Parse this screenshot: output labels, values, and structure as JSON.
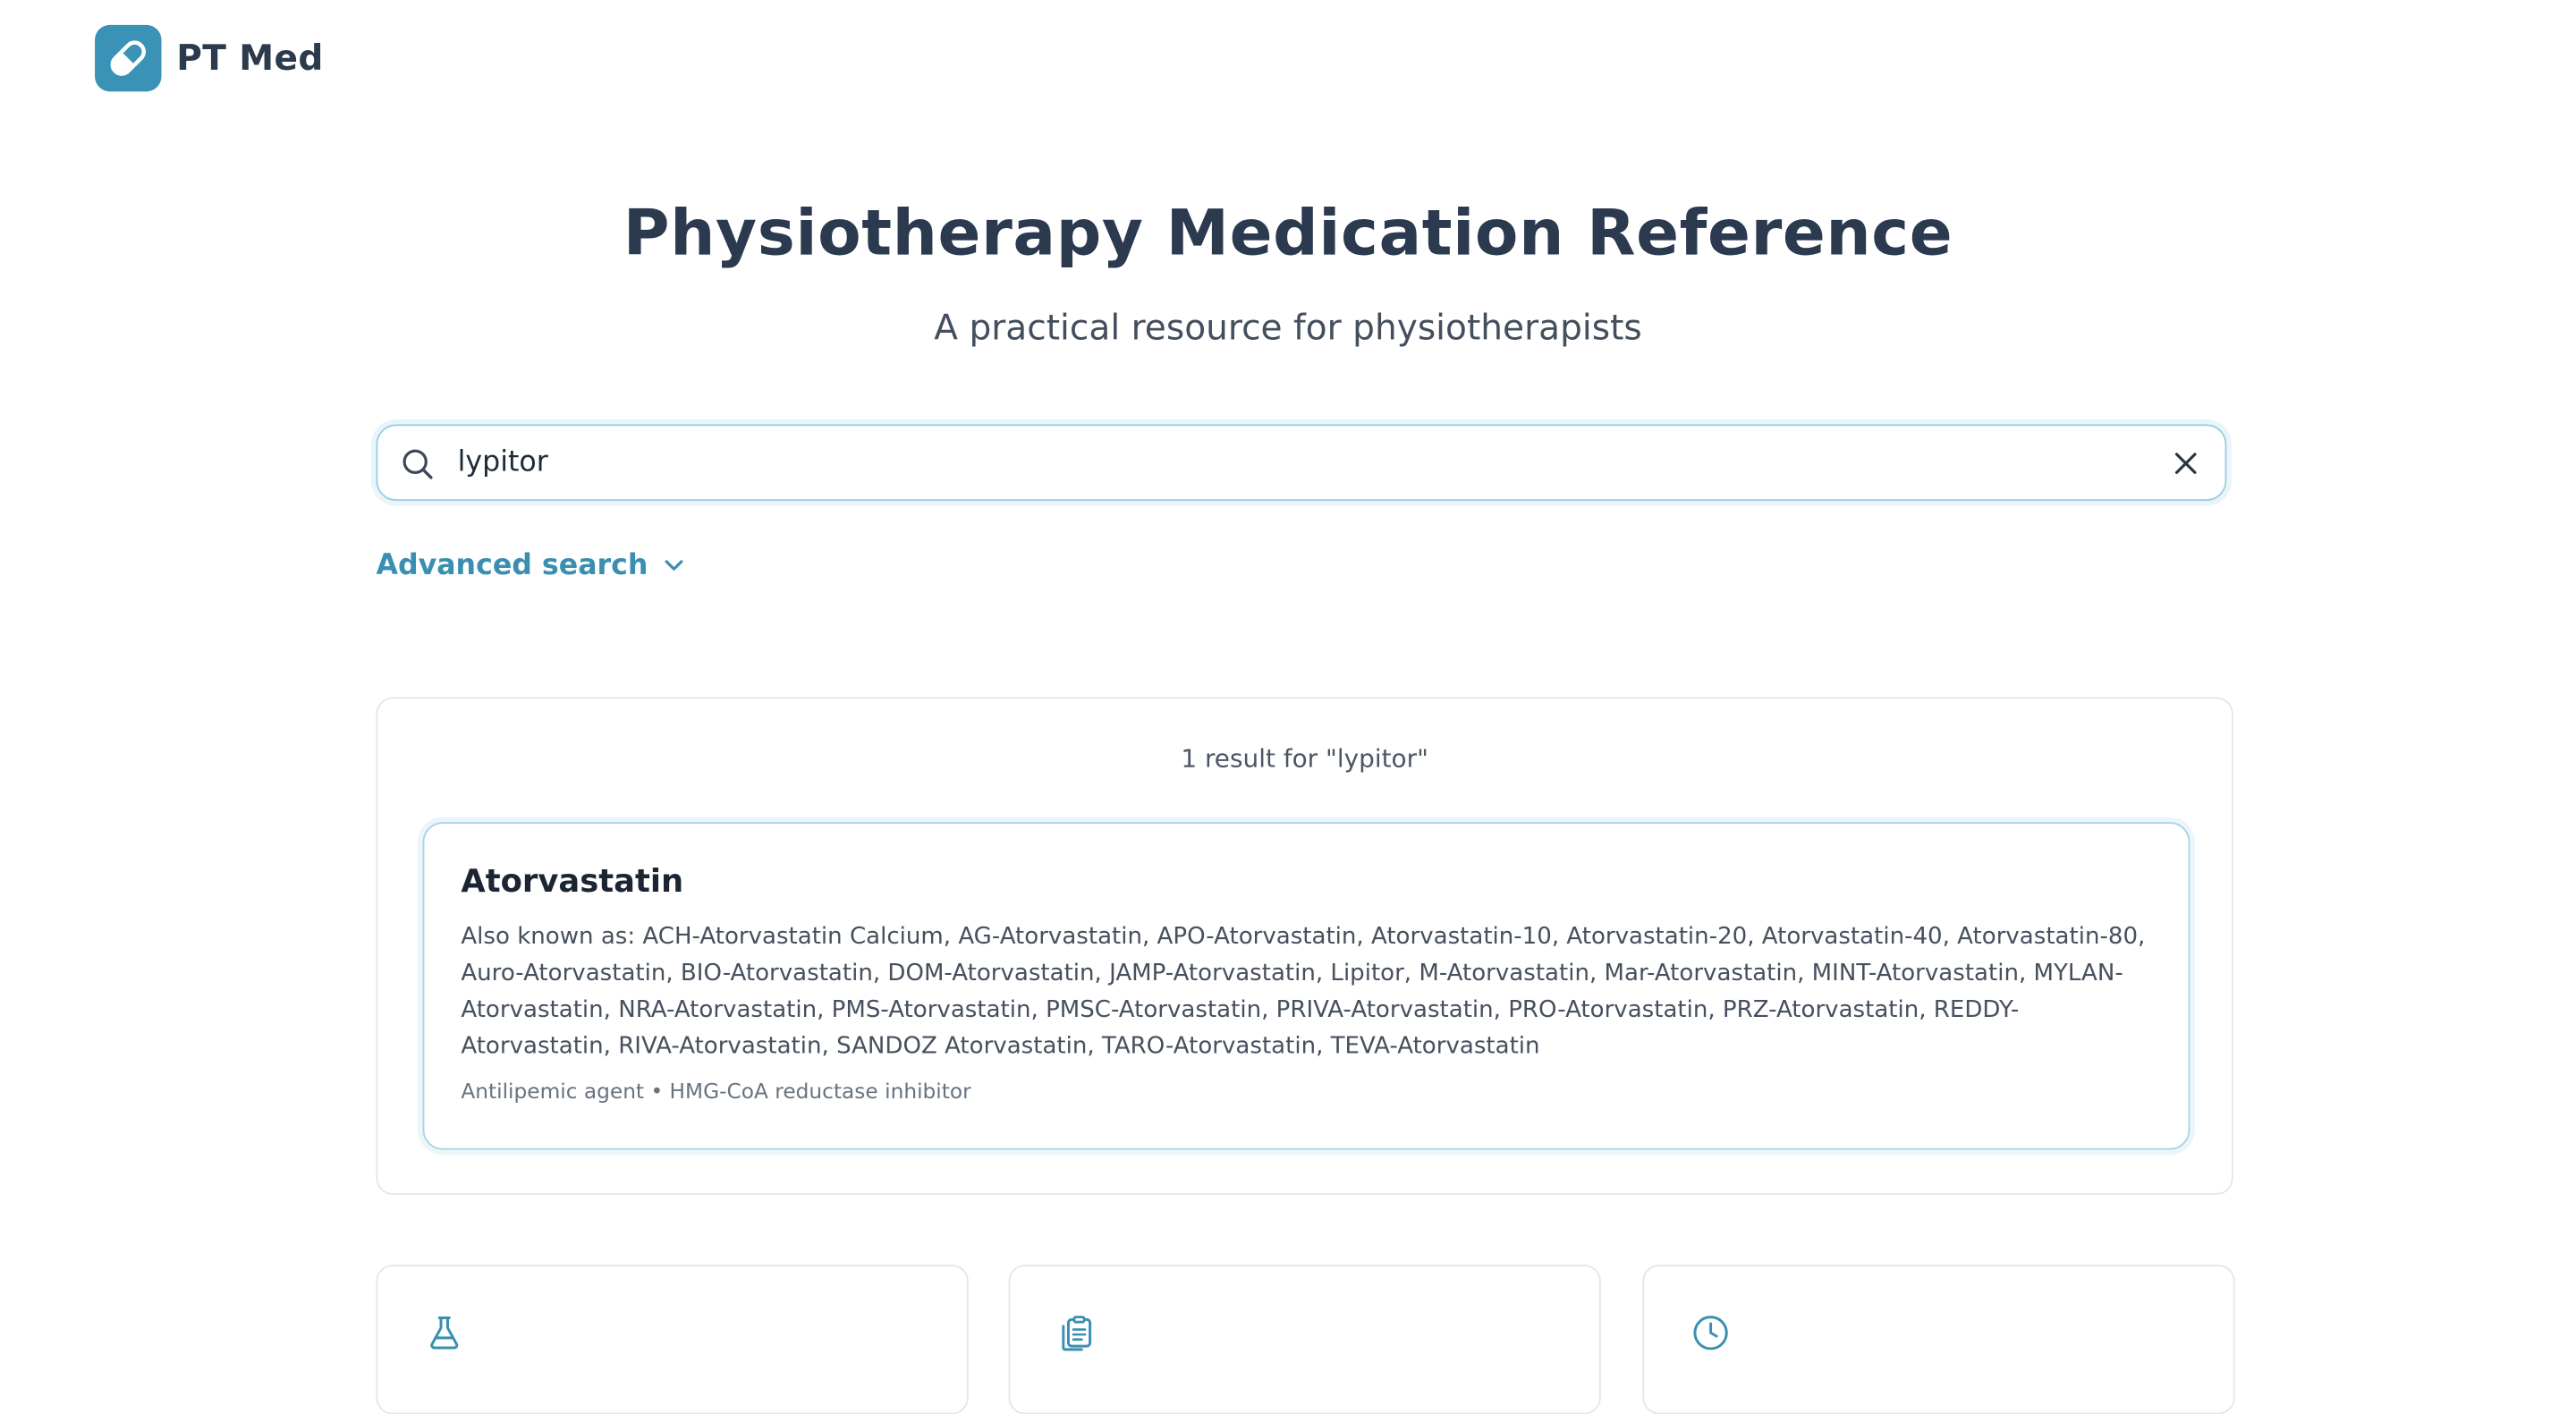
{
  "brand": {
    "name": "PT Med",
    "accent": "#3a93b6"
  },
  "header": {
    "title": "Physiotherapy Medication Reference",
    "subtitle": "A practical resource for physiotherapists"
  },
  "search": {
    "value": "lypitor",
    "advanced_label": "Advanced search"
  },
  "results": {
    "count_text": "1 result for \"lypitor\"",
    "items": [
      {
        "name": "Atorvastatin",
        "also_known_as": "Also known as: ACH-Atorvastatin Calcium, AG-Atorvastatin, APO-Atorvastatin, Atorvastatin-10, Atorvastatin-20, Atorvastatin-40, Atorvastatin-80, Auro-Atorvastatin, BIO-Atorvastatin, DOM-Atorvastatin, JAMP-Atorvastatin, Lipitor, M-Atorvastatin, Mar-Atorvastatin, MINT-Atorvastatin, MYLAN-Atorvastatin, NRA-Atorvastatin, PMS-Atorvastatin, PMSC-Atorvastatin, PRIVA-Atorvastatin, PRO-Atorvastatin, PRZ-Atorvastatin, REDDY-Atorvastatin, RIVA-Atorvastatin, SANDOZ Atorvastatin, TARO-Atorvastatin, TEVA-Atorvastatin",
        "classification": "Antilipemic agent • HMG-CoA reductase inhibitor"
      }
    ]
  },
  "feature_cards": [
    {
      "icon": "flask-icon"
    },
    {
      "icon": "clipboard-icon"
    },
    {
      "icon": "clock-icon"
    }
  ]
}
